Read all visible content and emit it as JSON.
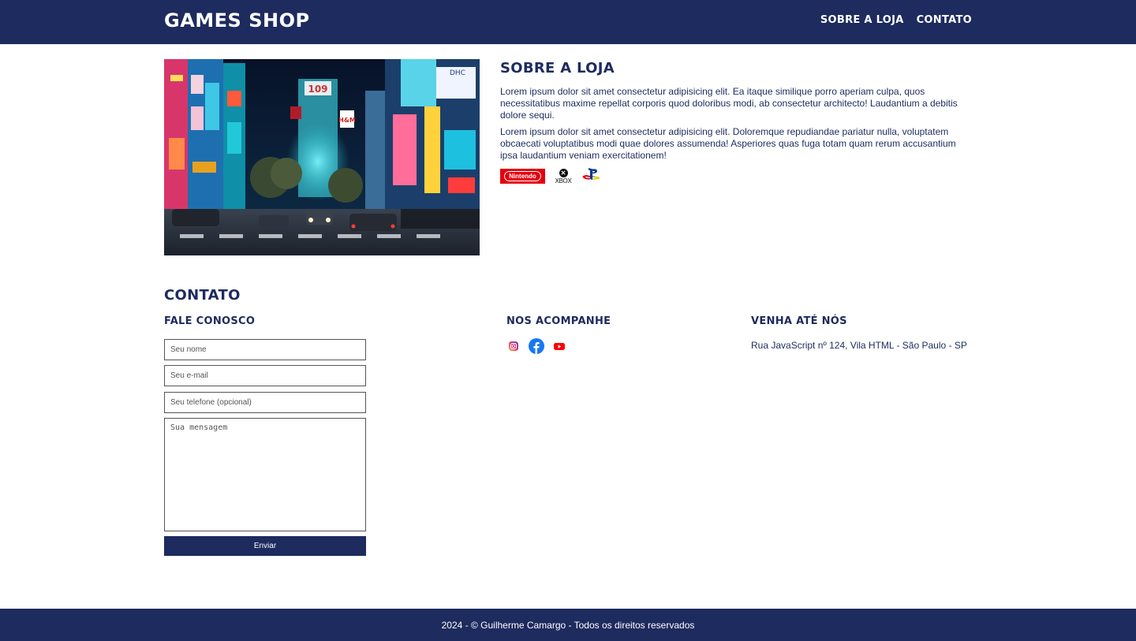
{
  "header": {
    "brand": "GAMES SHOP",
    "nav": [
      "SOBRE A LOJA",
      "CONTATO"
    ]
  },
  "about": {
    "title": "SOBRE A LOJA",
    "paragraphs": [
      "Lorem ipsum dolor sit amet consectetur adipisicing elit. Ea itaque similique porro aperiam culpa, quos necessitatibus maxime repellat corporis quod doloribus modi, ab consectetur architecto! Laudantium a debitis dolore sequi.",
      "Lorem ipsum dolor sit amet consectetur adipisicing elit. Doloremque repudiandae pariatur nulla, voluptatem obcaecati voluptatibus modi quae dolores assumenda! Asperiores quas fuga totam quam rerum accusantium ipsa laudantium veniam exercitationem!"
    ],
    "brand_logos": {
      "nintendo": "Nintendo",
      "xbox": "XBOX",
      "playstation": "playstation-icon"
    }
  },
  "contact": {
    "title": "CONTATO",
    "form_title": "FALE CONOSCO",
    "placeholders": {
      "name": "Seu nome",
      "email": "Seu e-mail",
      "phone": "Seu telefone (opcional)",
      "message": "Sua mensagem"
    },
    "submit_label": "Enviar",
    "social_title": "NOS ACOMPANHE",
    "social_icons": [
      "instagram-icon",
      "facebook-icon",
      "youtube-icon"
    ],
    "visit_title": "VENHA ATÉ NÓS",
    "address": "Rua JavaScript nº 124, Vila HTML - São Paulo - SP"
  },
  "footer": {
    "text": "2024 - © Guilherme Camargo - Todos os direitos reservados"
  },
  "colors": {
    "primary": "#1d2b5e",
    "nintendo_red": "#e4000f",
    "youtube_red": "#ff0000",
    "facebook_blue": "#1877f2"
  }
}
